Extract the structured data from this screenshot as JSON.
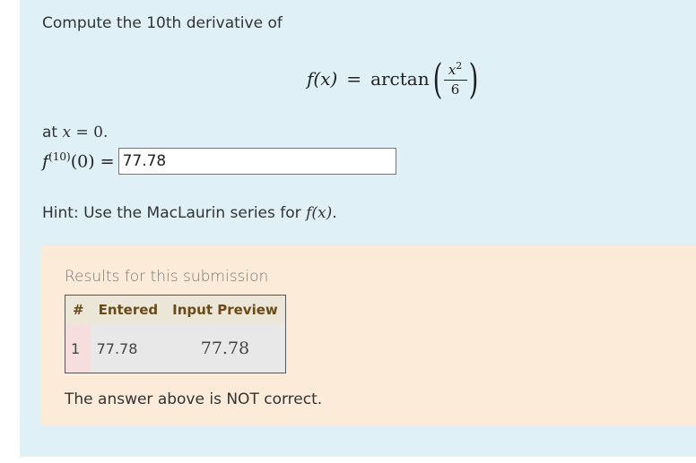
{
  "problem": {
    "prompt": "Compute the 10th derivative of",
    "formula": {
      "lhs": "f(x)",
      "eq": "=",
      "fn": "arctan",
      "num_base": "x",
      "num_exp": "2",
      "den": "6"
    },
    "at_prefix": "at",
    "at_var": "x",
    "at_eq": " = 0.",
    "answer_label": "f",
    "answer_label_sup": "(10)",
    "answer_label_suffix": "(0) =",
    "answer_value": "77.78",
    "hint_prefix": "Hint: Use the MacLaurin series for",
    "hint_math": "f(x)",
    "hint_suffix": "."
  },
  "results": {
    "title": "Results for this submission",
    "columns": [
      "#",
      "Entered",
      "Input Preview"
    ],
    "rows": [
      {
        "index": "1",
        "entered": "77.78",
        "preview": "77.78"
      }
    ],
    "verdict": "The answer above is NOT correct."
  },
  "colors": {
    "problem_bg": "#dff0f7",
    "results_bg": "#fcebd9",
    "header_text": "#6b4a1a"
  }
}
